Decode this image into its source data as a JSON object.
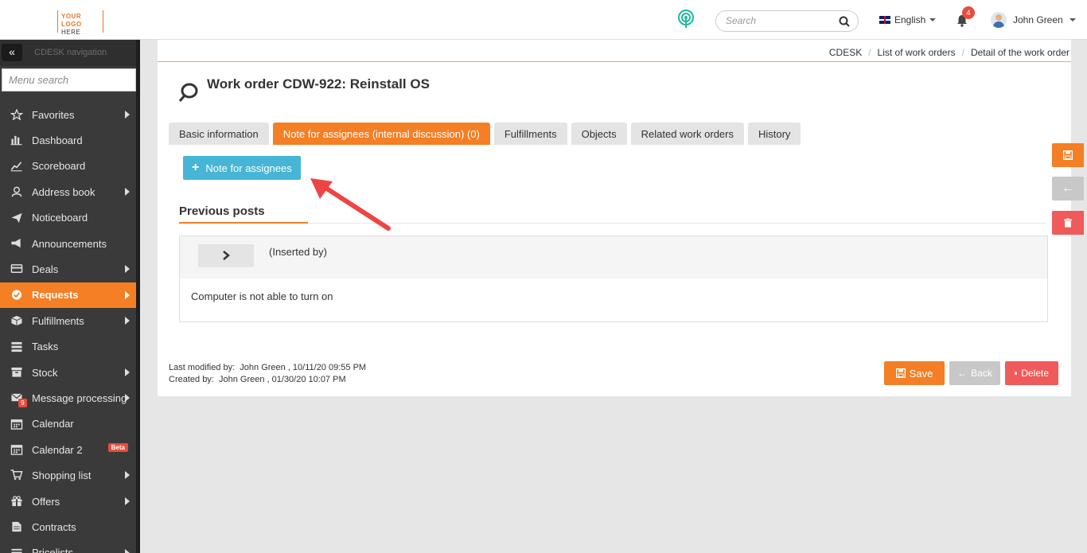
{
  "header": {
    "logo_line1": "YOUR LOGO",
    "logo_line2": "HERE",
    "search_placeholder": "Search",
    "language": "English",
    "notification_count": "4",
    "user_name": "John Green"
  },
  "sidebar": {
    "nav_title": "CDESK navigation",
    "menu_search_placeholder": "Menu search",
    "items": [
      {
        "label": "Favorites",
        "icon": "star-icon",
        "arrow": true
      },
      {
        "label": "Dashboard",
        "icon": "bar-chart-icon",
        "arrow": false
      },
      {
        "label": "Scoreboard",
        "icon": "line-chart-icon",
        "arrow": false
      },
      {
        "label": "Address book",
        "icon": "user-icon",
        "arrow": true
      },
      {
        "label": "Noticeboard",
        "icon": "paper-plane-icon",
        "arrow": false
      },
      {
        "label": "Announcements",
        "icon": "megaphone-icon",
        "arrow": false
      },
      {
        "label": "Deals",
        "icon": "credit-card-icon",
        "arrow": true
      },
      {
        "label": "Requests",
        "icon": "check-circle-icon",
        "arrow": true,
        "active": true
      },
      {
        "label": "Fulfillments",
        "icon": "box-icon",
        "arrow": true
      },
      {
        "label": "Tasks",
        "icon": "tasks-icon",
        "arrow": false
      },
      {
        "label": "Stock",
        "icon": "archive-icon",
        "arrow": true
      },
      {
        "label": "Message processing",
        "icon": "envelope-icon",
        "arrow": true,
        "badge": "9"
      },
      {
        "label": "Calendar",
        "icon": "calendar-icon",
        "arrow": false
      },
      {
        "label": "Calendar 2",
        "icon": "calendar-icon",
        "arrow": false,
        "beta": "Beta"
      },
      {
        "label": "Shopping list",
        "icon": "cart-icon",
        "arrow": true
      },
      {
        "label": "Offers",
        "icon": "gift-icon",
        "arrow": true
      },
      {
        "label": "Contracts",
        "icon": "document-icon",
        "arrow": false
      },
      {
        "label": "Pricelists",
        "icon": "list-icon",
        "arrow": true
      }
    ]
  },
  "breadcrumb": [
    "CDESK",
    "List of work orders",
    "Detail of the work order"
  ],
  "page_title": "Work order CDW-922: Reinstall OS",
  "tabs": [
    {
      "label": "Basic information",
      "active": false
    },
    {
      "label": "Note for assignees (internal discussion) (0)",
      "active": true
    },
    {
      "label": "Fulfillments",
      "active": false
    },
    {
      "label": "Objects",
      "active": false
    },
    {
      "label": "Related work orders",
      "active": false
    },
    {
      "label": "History",
      "active": false
    }
  ],
  "note_button": "Note for assignees",
  "previous_posts": {
    "title": "Previous posts",
    "inserted_by": "(Inserted by)",
    "body": "Computer is not able to turn on"
  },
  "meta": {
    "last_modified_label": "Last modified by:",
    "last_modified_value": "John Green , 10/11/20 09:55 PM",
    "created_label": "Created by:",
    "created_value": "John Green , 01/30/20 10:07 PM"
  },
  "actions": {
    "save": "Save",
    "back": "Back",
    "delete": "Delete"
  },
  "colors": {
    "accent": "#f47f24",
    "info": "#46b5d6",
    "danger": "#ef5a5a",
    "sidebar_bg": "#3a3a3a"
  }
}
